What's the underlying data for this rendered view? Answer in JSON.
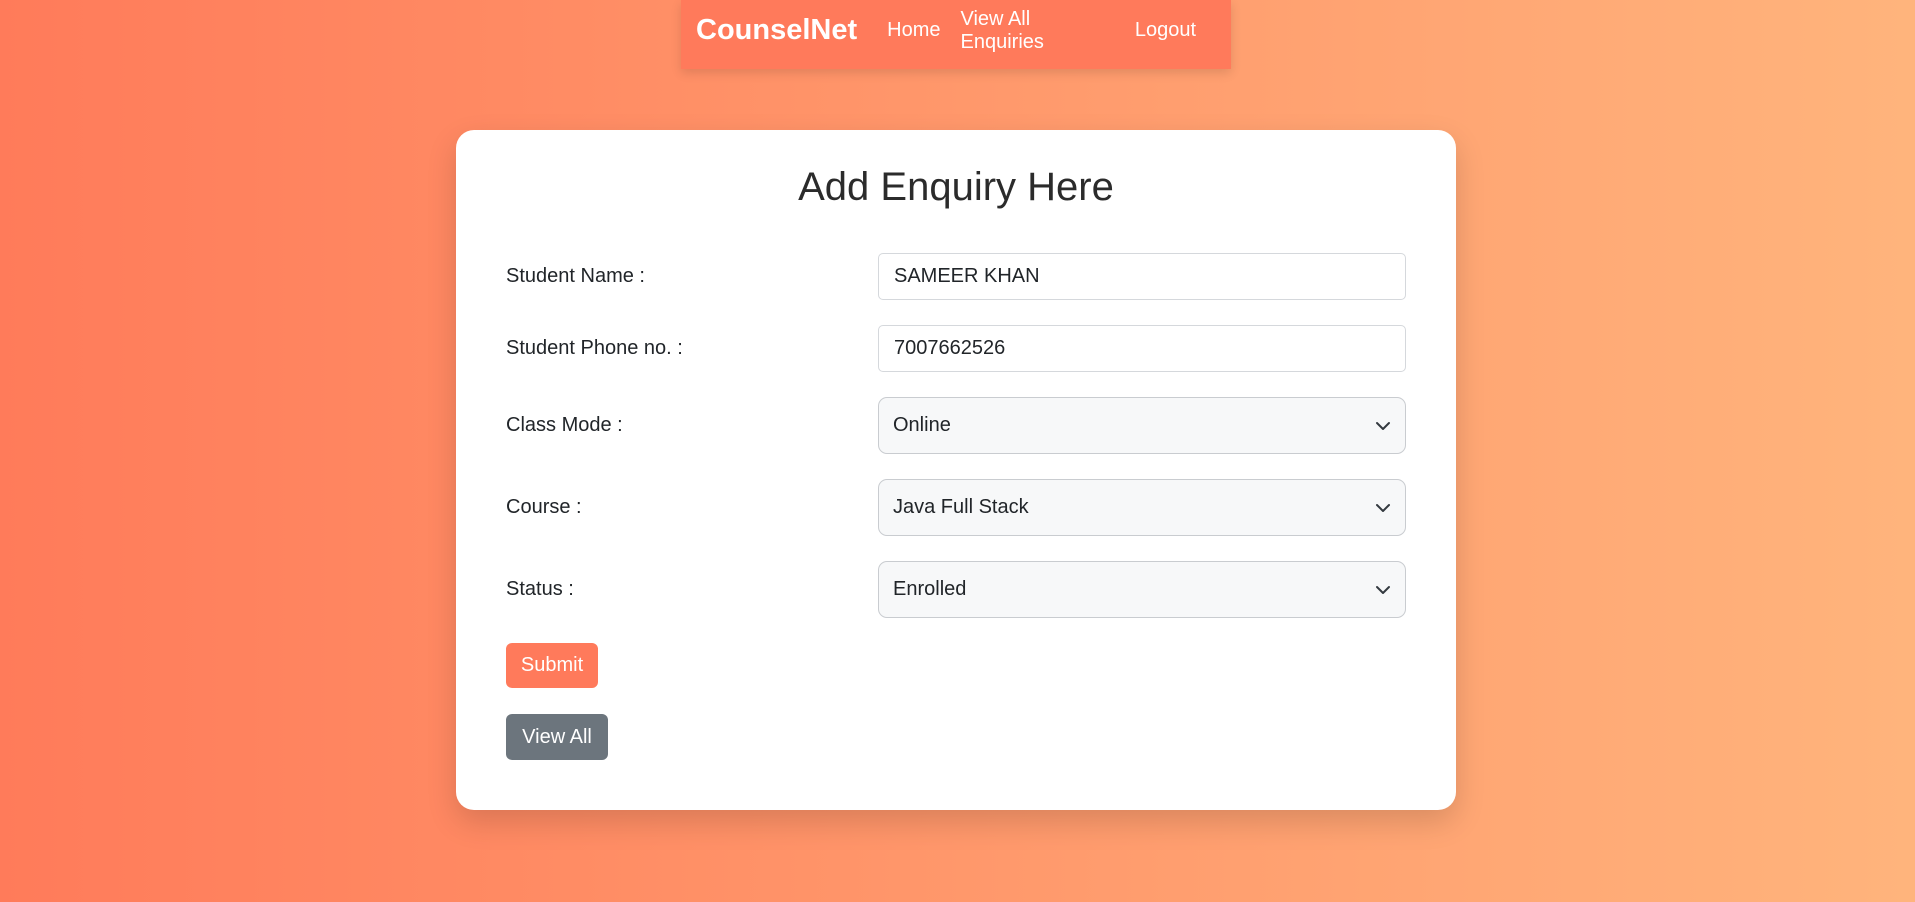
{
  "navbar": {
    "brand": "CounselNet",
    "links": [
      "Home",
      "View All Enquiries",
      "Logout"
    ]
  },
  "form": {
    "title": "Add Enquiry Here",
    "student_name": {
      "label": "Student Name :",
      "value": "SAMEER KHAN"
    },
    "student_phone": {
      "label": "Student Phone no. :",
      "value": "7007662526"
    },
    "class_mode": {
      "label": "Class Mode :",
      "selected": "Online"
    },
    "course": {
      "label": "Course :",
      "selected": "Java Full Stack"
    },
    "status": {
      "label": "Status :",
      "selected": "Enrolled"
    },
    "submit_label": "Submit",
    "view_all_label": "View All"
  },
  "colors": {
    "accent": "#ff7a5b",
    "secondary": "#6c757d",
    "gradient_start": "#ff7b5a",
    "gradient_end": "#ffb47c"
  },
  "icons": {
    "select_arrow": "chevron-down-icon"
  }
}
